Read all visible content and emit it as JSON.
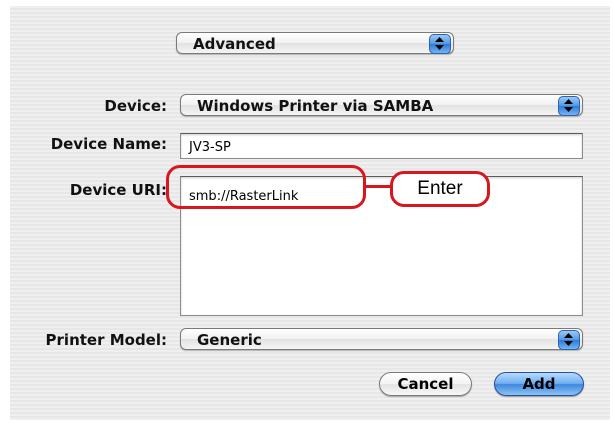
{
  "section_popup": {
    "value": "Advanced",
    "icon": "up-down-arrows-icon"
  },
  "device": {
    "label": "Device:",
    "value": "Windows Printer via SAMBA"
  },
  "device_name": {
    "label": "Device Name:",
    "value": "JV3-SP"
  },
  "device_uri": {
    "label": "Device URI:",
    "value": "smb://RasterLink"
  },
  "annotation": {
    "callout_text": "Enter",
    "color": "#d8161e"
  },
  "printer_model": {
    "label": "Printer Model:",
    "value": "Generic"
  },
  "buttons": {
    "cancel": "Cancel",
    "add": "Add"
  },
  "colors": {
    "accent_blue": "#4f97e4",
    "panel_bg": "#ececec"
  }
}
